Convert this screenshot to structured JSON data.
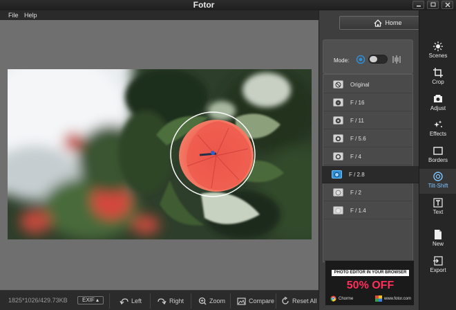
{
  "window": {
    "title": "Fotor"
  },
  "menu": {
    "items": [
      "File",
      "Help"
    ]
  },
  "image_info": "1825*1026/429.73KB",
  "bottom": {
    "exif": "EXIF",
    "left": "Left",
    "right": "Right",
    "zoom": "Zoom",
    "compare": "Compare",
    "reset_all": "Reset All"
  },
  "panel": {
    "home": "Home",
    "mode_label": "Mode:",
    "apertures": [
      "Original",
      "F / 16",
      "F / 11",
      "F / 5.6",
      "F / 4",
      "F / 2.8",
      "F / 2",
      "F / 1.4"
    ],
    "selected_aperture": "F / 2.8"
  },
  "ad": {
    "headline": "PHOTO EDITOR IN YOUR BROWSER",
    "offer": "50% OFF",
    "browser": "Chorme",
    "site": "www.fotor.com"
  },
  "tools": [
    "Scenes",
    "Crop",
    "Adjust",
    "Effects",
    "Borders",
    "Tilt-Shift",
    "Text",
    "New",
    "Export"
  ],
  "selected_tool": "Tilt-Shift",
  "colors": {
    "accent": "#2f8fd8",
    "ad_offer": "#ff2f5a",
    "flower": "#ef5a4c"
  }
}
